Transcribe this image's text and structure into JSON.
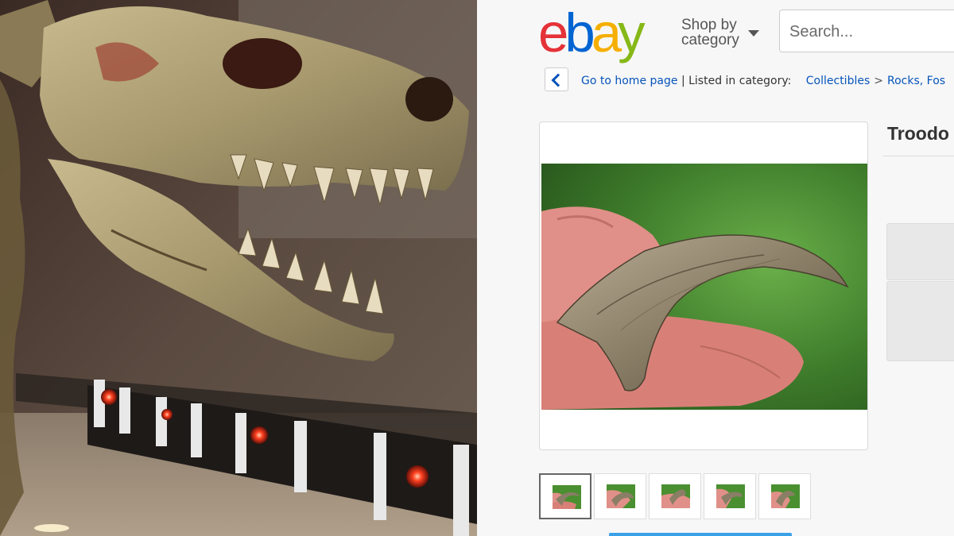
{
  "photo": {
    "subject": "T. rex skeleton museum display"
  },
  "ebay": {
    "logo": {
      "e": "e",
      "b": "b",
      "a": "a",
      "y": "y"
    },
    "shop_by": {
      "line1": "Shop by",
      "line2": "category"
    },
    "search": {
      "placeholder": "Search..."
    },
    "breadcrumb": {
      "back_label": "Go to home page",
      "listed_in": "| Listed in category:",
      "categories": [
        "Collectibles",
        "Rocks, Fos"
      ],
      "separator": ">"
    },
    "item": {
      "title": "Troodo"
    },
    "thumbnails": [
      {
        "label": "thumbnail 1",
        "selected": true
      },
      {
        "label": "thumbnail 2",
        "selected": false
      },
      {
        "label": "thumbnail 3",
        "selected": false
      },
      {
        "label": "thumbnail 4",
        "selected": false
      },
      {
        "label": "thumbnail 5",
        "selected": false
      }
    ],
    "colors": {
      "link": "#0654ba",
      "logo_red": "#e53238",
      "logo_blue": "#0064d2",
      "logo_yellow": "#f5af02",
      "logo_green": "#86b817"
    }
  }
}
